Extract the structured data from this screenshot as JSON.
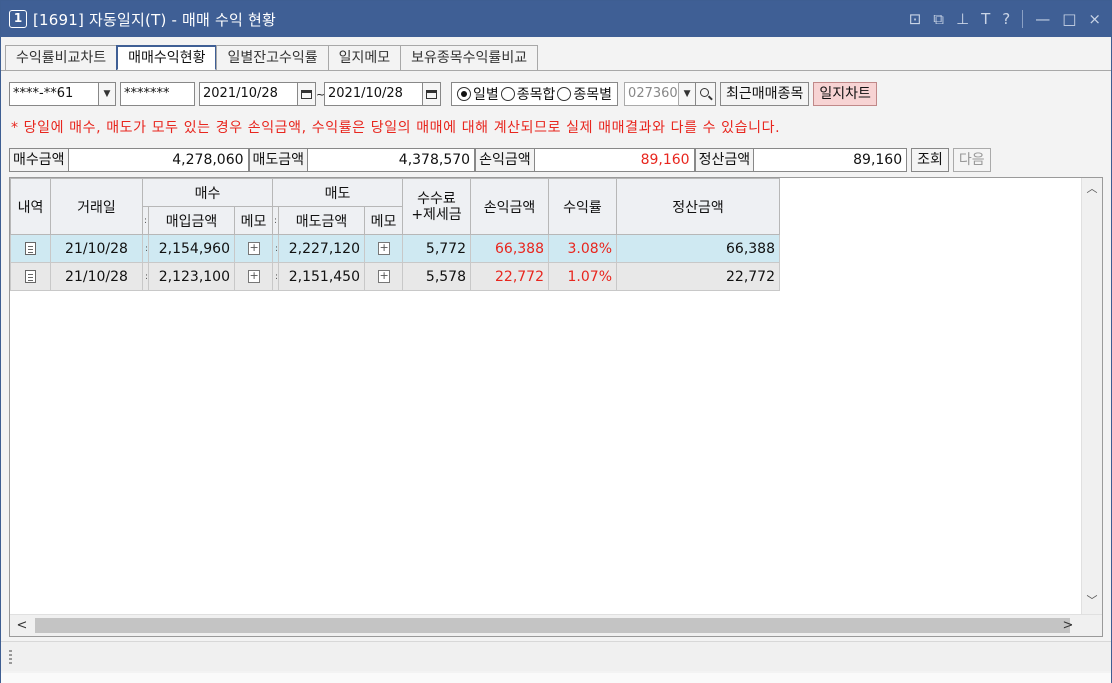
{
  "window": {
    "number": "1",
    "title": "[1691] 자동일지(T) - 매매 수익 현황",
    "controls": [
      "⊡",
      "⧉",
      "⊥",
      "T",
      "?",
      "—",
      "□",
      "×"
    ]
  },
  "tabs": [
    {
      "label": "수익률비교차트",
      "active": false
    },
    {
      "label": "매매수익현황",
      "active": true
    },
    {
      "label": "일별잔고수익률",
      "active": false
    },
    {
      "label": "일지메모",
      "active": false
    },
    {
      "label": "보유종목수익률비교",
      "active": false
    }
  ],
  "toolbar": {
    "account": "****-**61",
    "password": "*******",
    "date_from": "2021/10/28",
    "tilde": "~",
    "date_to": "2021/10/28",
    "radio_daily": "일별",
    "radio_sum": "종목합",
    "radio_by_item": "종목별",
    "stock_code": "027360",
    "recent_button": "최근매매종목",
    "chart_button": "일지차트",
    "selected_radio": "일별"
  },
  "notice": "* 당일에 매수, 매도가 모두 있는 경우 손익금액, 수익률은 당일의 매매에 대해 계산되므로 실제 매매결과와 다를 수 있습니다.",
  "summary": {
    "buy_label": "매수금액",
    "buy_value": "4,278,060",
    "sell_label": "매도금액",
    "sell_value": "4,378,570",
    "pnl_label": "손익금액",
    "pnl_value": "89,160",
    "settle_label": "정산금액",
    "settle_value": "89,160",
    "query_button": "조회",
    "next_button": "다음"
  },
  "grid": {
    "headers": {
      "detail": "내역",
      "date": "거래일",
      "buy": "매수",
      "buy_amount": "매입금액",
      "buy_memo": "메모",
      "sell": "매도",
      "sell_amount": "매도금액",
      "sell_memo": "메모",
      "fee_line1": "수수료",
      "fee_line2": "+제세금",
      "pnl": "손익금액",
      "rate": "수익률",
      "settle": "정산금액"
    },
    "rows": [
      {
        "date": "21/10/28",
        "buy_amount": "2,154,960",
        "sell_amount": "2,227,120",
        "fee": "5,772",
        "pnl": "66,388",
        "rate": "3.08%",
        "settle": "66,388"
      },
      {
        "date": "21/10/28",
        "buy_amount": "2,123,100",
        "sell_amount": "2,151,450",
        "fee": "5,578",
        "pnl": "22,772",
        "rate": "1.07%",
        "settle": "22,772"
      }
    ]
  },
  "colors": {
    "titlebar": "#3f5f95",
    "row_selected": "#cfe9f2",
    "row_alt": "#e8e8e8",
    "profit_red": "#e8261e",
    "pink_button": "#f7d3d3"
  }
}
